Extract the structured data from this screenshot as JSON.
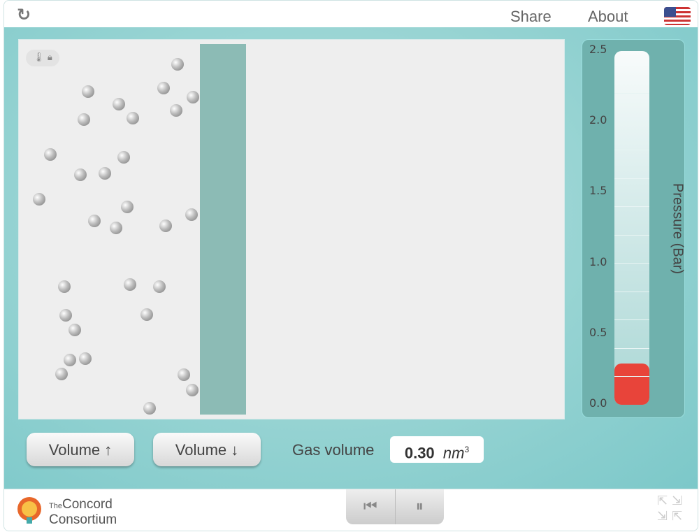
{
  "topbar": {
    "reload_icon": "reload-icon",
    "share_label": "Share",
    "about_label": "About",
    "language_icon": "us-flag-icon"
  },
  "simulation": {
    "status_icons": [
      "thermometer-icon",
      "lock-icon"
    ]
  },
  "pressure_gauge": {
    "label": "Pressure (Bar)",
    "ticks": [
      "2.5",
      "2.0",
      "1.5",
      "1.0",
      "0.5",
      "0.0"
    ],
    "range": [
      0,
      2.5
    ],
    "value": 0.29,
    "fill_color": "#e8443a"
  },
  "controls": {
    "volume_up_label": "Volume ↑",
    "volume_down_label": "Volume ↓",
    "gas_volume_label": "Gas volume",
    "gas_volume_value": "0.30",
    "gas_volume_unit": "nm",
    "gas_volume_exp": "3"
  },
  "footer": {
    "logo_small": "The",
    "logo_line1": "Concord",
    "logo_line2": "Consortium",
    "reset_icon": "skip-back-icon",
    "pause_icon": "pause-icon",
    "fullscreen_icon": "fullscreen-icon"
  }
}
